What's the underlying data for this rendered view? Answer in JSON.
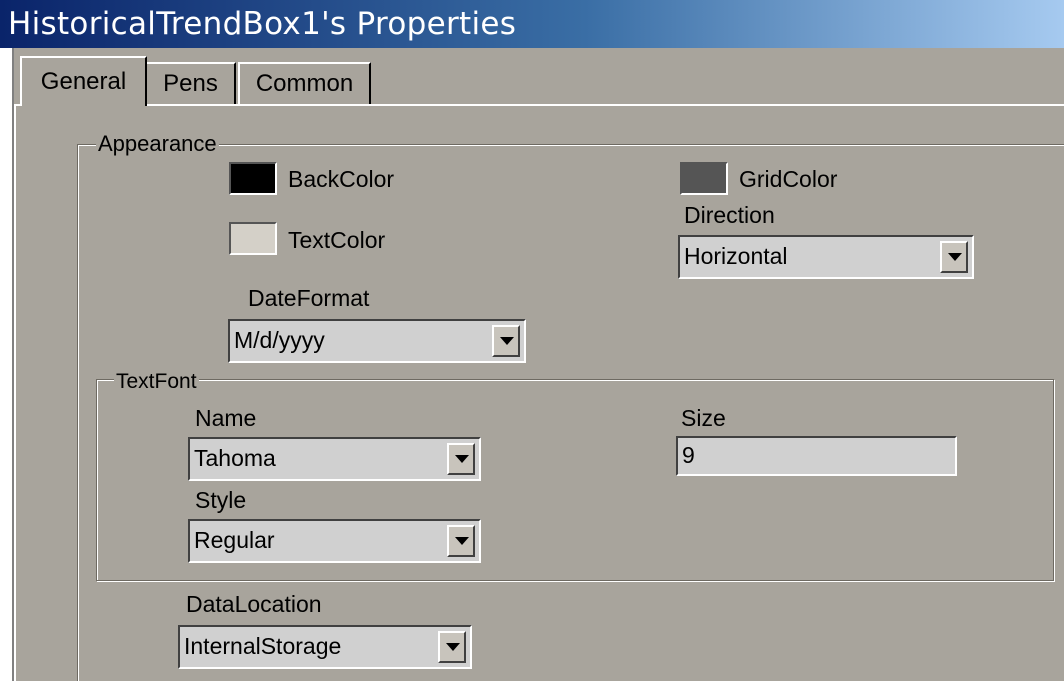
{
  "window": {
    "title": "HistoricalTrendBox1's Properties"
  },
  "tabs": [
    {
      "label": "General"
    },
    {
      "label": "Pens"
    },
    {
      "label": "Common"
    }
  ],
  "appearance": {
    "legend": "Appearance",
    "backcolor": {
      "label": "BackColor",
      "color": "#000000"
    },
    "gridcolor": {
      "label": "GridColor",
      "color": "#555555"
    },
    "textcolor": {
      "label": "TextColor",
      "color": "#d4d0c8"
    },
    "direction": {
      "label": "Direction",
      "value": "Horizontal"
    },
    "dateformat": {
      "label": "DateFormat",
      "value": "M/d/yyyy"
    }
  },
  "textfont": {
    "legend": "TextFont",
    "name": {
      "label": "Name",
      "value": "Tahoma"
    },
    "size": {
      "label": "Size",
      "value": "9"
    },
    "style": {
      "label": "Style",
      "value": "Regular"
    }
  },
  "datalocation": {
    "label": "DataLocation",
    "value": "InternalStorage"
  },
  "icons": {
    "dropdown": "dropdown-arrow-icon"
  }
}
